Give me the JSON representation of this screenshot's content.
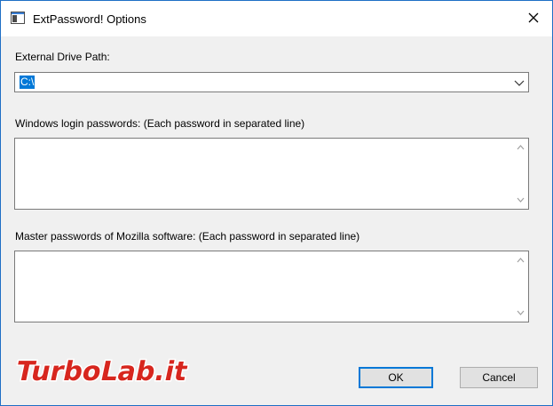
{
  "window": {
    "title": "ExtPassword! Options"
  },
  "fields": {
    "drive_label": "External Drive Path:",
    "drive_value": "C:\\",
    "windows_label": "Windows login passwords: (Each password in separated line)",
    "windows_value": "",
    "mozilla_label": "Master passwords of Mozilla software: (Each password in separated line)",
    "mozilla_value": ""
  },
  "buttons": {
    "ok": "OK",
    "cancel": "Cancel"
  },
  "watermark": {
    "text": "TurboLab.it"
  },
  "colors": {
    "window_border": "#1f6fc5",
    "selection": "#0078d7",
    "watermark_red": "#d7261e"
  },
  "icons": [
    "app-icon",
    "close-icon",
    "chevron-down-icon",
    "scroll-up-icon",
    "scroll-down-icon"
  ]
}
